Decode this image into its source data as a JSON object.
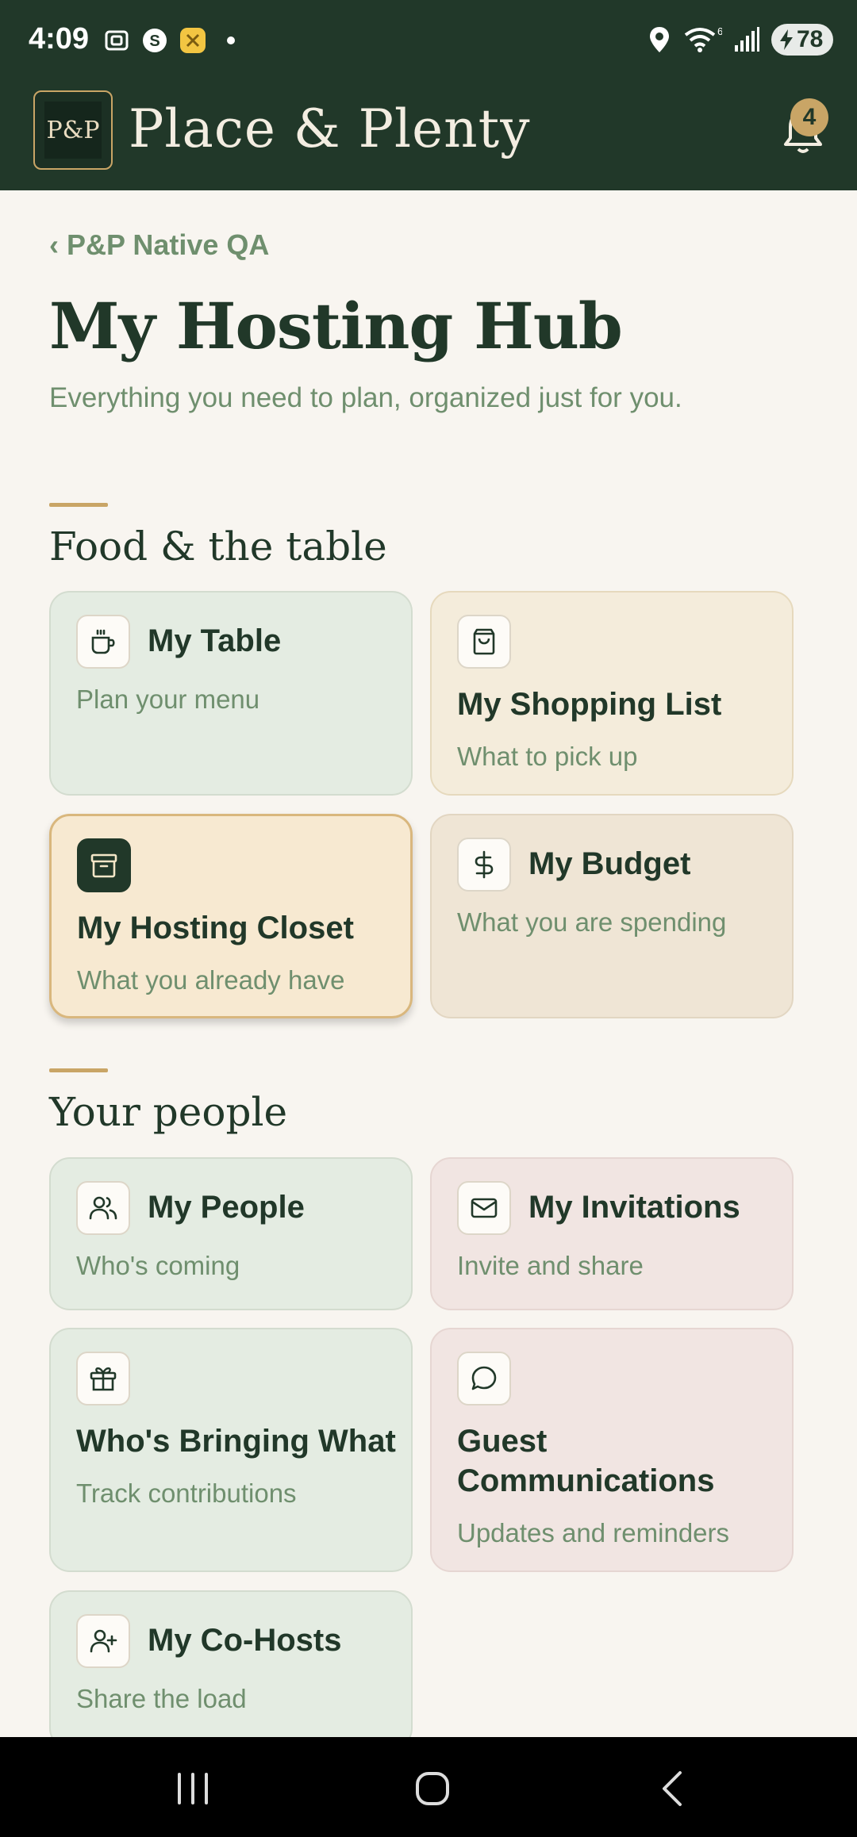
{
  "status_bar": {
    "time": "4:09",
    "battery": "78",
    "wifi_label": "6"
  },
  "header": {
    "logo_text": "P&P",
    "brand": "Place & Plenty",
    "notification_count": "4"
  },
  "page": {
    "back_label": "‹ P&P Native QA",
    "title": "My Hosting Hub",
    "subtitle": "Everything you need to plan, organized just for you."
  },
  "sections": [
    {
      "title": "Food & the table",
      "cards": [
        {
          "title": "My Table",
          "desc": "Plan your menu",
          "icon": "coffee-cup-icon"
        },
        {
          "title": "My Shopping List",
          "desc": "What to pick up",
          "icon": "shopping-bag-icon"
        },
        {
          "title": "My Hosting Closet",
          "desc": "What you already have",
          "icon": "archive-box-icon"
        },
        {
          "title": "My Budget",
          "desc": "What you are spending",
          "icon": "dollar-icon"
        }
      ]
    },
    {
      "title": "Your people",
      "cards": [
        {
          "title": "My People",
          "desc": "Who's coming",
          "icon": "users-icon"
        },
        {
          "title": "My Invitations",
          "desc": "Invite and share",
          "icon": "envelope-icon"
        },
        {
          "title": "Who's Bringing What",
          "desc": "Track contributions",
          "icon": "gift-icon"
        },
        {
          "title": "Guest Communications",
          "desc": "Updates and reminders",
          "icon": "chat-bubble-icon"
        },
        {
          "title": "My Co-Hosts",
          "desc": "Share the load",
          "icon": "user-plus-icon"
        }
      ]
    }
  ],
  "colors": {
    "brand_dark": "#213829",
    "accent_gold": "#c9a566",
    "muted_green_text": "#6f8f6e",
    "background": "#f8f5f0"
  }
}
